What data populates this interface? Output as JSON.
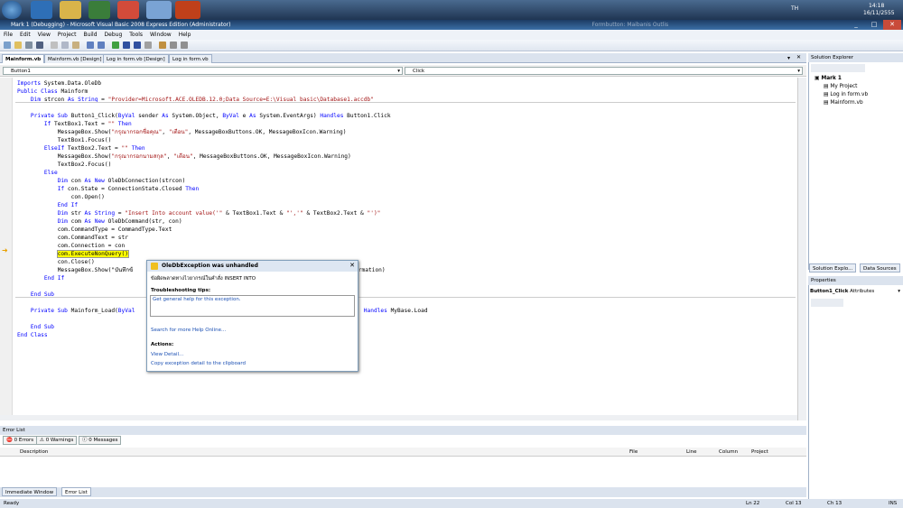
{
  "taskbar": {
    "lang": "TH",
    "time": "14:18",
    "date": "16/11/2555"
  },
  "window": {
    "title": "Mark 1 (Debugging) - Microsoft Visual Basic 2008 Express Edition (Administrator)",
    "bg_text": "Formbutton: Maibanis Outlis"
  },
  "menu": [
    "File",
    "Edit",
    "View",
    "Project",
    "Build",
    "Debug",
    "Tools",
    "Window",
    "Help"
  ],
  "tabs": [
    "Mainform.vb",
    "Mainform.vb [Design]",
    "Log in form.vb [Design]",
    "Log in form.vb"
  ],
  "combos": {
    "left": "Button1",
    "right": "Click"
  },
  "code": [
    {
      "t": "Imports System.Data.OleDb"
    },
    {
      "t": "Public Class Mainform"
    },
    {
      "t": "    Dim strcon As String = \"Provider=Microsoft.ACE.OLEDB.12.0;Data Source=E:\\Visual_basic\\Database1.accdb\""
    },
    {
      "t": ""
    },
    {
      "t": "    Private Sub Button1_Click(ByVal sender As System.Object, ByVal e As System.EventArgs) Handles Button1.Click"
    },
    {
      "t": "        If TextBox1.Text = \"\" Then"
    },
    {
      "t": "            MessageBox.Show(\"กรุณากรอกชื่อคุณ\", \"เตือน\", MessageBoxButtons.OK, MessageBoxIcon.Warning)"
    },
    {
      "t": "            TextBox1.Focus()"
    },
    {
      "t": "        ElseIf TextBox2.Text = \"\" Then"
    },
    {
      "t": "            MessageBox.Show(\"กรุณากรอกนามสกุล\", \"เตือน\", MessageBoxButtons.OK, MessageBoxIcon.Warning)"
    },
    {
      "t": "            TextBox2.Focus()"
    },
    {
      "t": "        Else"
    },
    {
      "t": "            Dim con As New OleDbConnection(strcon)"
    },
    {
      "t": "            If con.State = ConnectionState.Closed Then"
    },
    {
      "t": "                con.Open()"
    },
    {
      "t": "            End If"
    },
    {
      "t": "            Dim str As String = \"Insert Into account value('\" & TextBox1.Text & \"','\" & TextBox2.Text & \"')\""
    },
    {
      "t": "            Dim com As New OleDbCommand(str, con)"
    },
    {
      "t": "            com.CommandType = CommandType.Text"
    },
    {
      "t": "            com.CommandText = str"
    },
    {
      "t": "            com.Connection = con"
    },
    {
      "t": "            com.ExecuteNonQuery()",
      "hl": true
    },
    {
      "t": "            con.Close()"
    },
    {
      "t": "            MessageBox.Show(\"บันทึกข้                                                                  ormation)"
    },
    {
      "t": "        End If"
    },
    {
      "t": ""
    },
    {
      "t": "    End Sub"
    },
    {
      "t": ""
    },
    {
      "t": "    Private Sub Mainform_Load(ByVal                                                                    Handles MyBase.Load"
    },
    {
      "t": ""
    },
    {
      "t": "    End Sub"
    },
    {
      "t": "End Class"
    }
  ],
  "exception": {
    "title": "OleDbException was unhandled",
    "message": "ข้อผิดพลาดทางไวยากรณ์ในคำสั่ง INSERT INTO",
    "tips_label": "Troubleshooting tips:",
    "tip_link": "Get general help for this exception.",
    "help_link": "Search for more Help Online...",
    "actions_label": "Actions:",
    "action1": "View Detail...",
    "action2": "Copy exception detail to the clipboard"
  },
  "errorlist": {
    "title": "Error List",
    "errors": "0 Errors",
    "warnings": "0 Warnings",
    "messages": "0 Messages",
    "cols": [
      "Description",
      "File",
      "Line",
      "Column",
      "Project"
    ]
  },
  "bottom_tabs": [
    "Immediate Window",
    "Error List"
  ],
  "status": {
    "ready": "Ready",
    "ln": "Ln 22",
    "col": "Col 13",
    "ch": "Ch 13",
    "ins": "INS"
  },
  "solution": {
    "title": "Solution Explorer",
    "root": "Mark 1",
    "items": [
      "My Project",
      "Log in form.vb",
      "Mainform.vb"
    ],
    "tab1": "Solution Explo...",
    "tab2": "Data Sources"
  },
  "properties": {
    "title": "Properties",
    "object": "Button1_Click",
    "attr": "Attributes"
  }
}
